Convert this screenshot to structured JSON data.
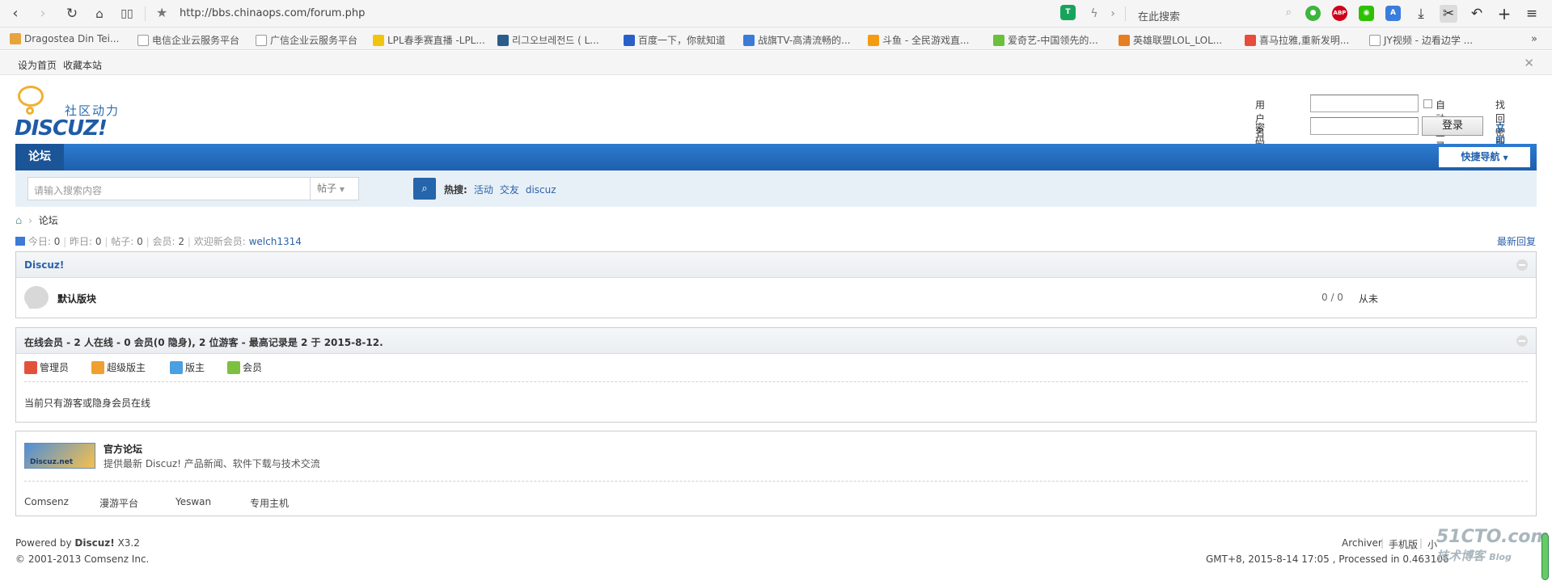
{
  "browser": {
    "url": "http://bbs.chinaops.com/forum.php",
    "search_placeholder": "在此搜索",
    "bookmarks": [
      "Dragostea Din Tei...",
      "电信企业云服务平台",
      "广信企业云服务平台",
      "LPL春季赛直播 -LPL...",
      "리그오브레전드 ( L...",
      "百度一下，你就知道",
      "战旗TV-高清流畅的...",
      "斗鱼 - 全民游戏直...",
      "爱奇艺-中国领先的...",
      "英雄联盟LOL_LOL...",
      "喜马拉雅,重新发明...",
      "JY视频 - 边看边学 ..."
    ],
    "bookmark_colors": [
      "#e8a33c",
      "#ffffff",
      "#ffffff",
      "#f1c40f",
      "#2b5d8b",
      "#2b5fc8",
      "#3c7bd6",
      "#f39c12",
      "#6cbf3a",
      "#e67e22",
      "#e74c3c",
      "#ffffff"
    ],
    "ext_labels": {
      "abp": "ABP"
    }
  },
  "site_bar": {
    "set_home": "设为首页",
    "bookmark": "收藏本站"
  },
  "logo": {
    "cn": "社区动力",
    "en": "DISCUZ!"
  },
  "login": {
    "username_label": "用户名",
    "password_label": "密码",
    "auto_login": "自动登录",
    "retrieve_password": "找回密码",
    "login_button": "登录",
    "register": "立即注册"
  },
  "nav": {
    "tab": "论坛",
    "quick_nav": "快捷导航"
  },
  "search": {
    "placeholder": "请输入搜索内容",
    "type": "帖子",
    "hot_label": "热搜:",
    "hot": [
      "活动",
      "交友",
      "discuz"
    ]
  },
  "breadcrumb": {
    "current": "论坛"
  },
  "stats": {
    "today_label": "今日:",
    "today": "0",
    "yesterday_label": "昨日:",
    "yesterday": "0",
    "posts_label": "帖子:",
    "posts": "0",
    "members_label": "会员:",
    "members": "2",
    "welcome_label": "欢迎新会员:",
    "newest_member": "welch1314",
    "latest_replies": "最新回复"
  },
  "category": {
    "title": "Discuz!",
    "forum": {
      "name": "默认版块",
      "counts": "0 / 0",
      "last_post": "从未"
    }
  },
  "online": {
    "title": "在线会员 - 2 人在线 - 0 会员(0 隐身), 2 位游客 - 最高记录是 2 于 2015-8-12.",
    "legend": [
      "管理员",
      "超级版主",
      "版主",
      "会员"
    ],
    "legend_colors": [
      "#e2523a",
      "#f0a030",
      "#4aa0e0",
      "#7cc040"
    ],
    "message": "当前只有游客或隐身会员在线"
  },
  "links": {
    "official_name": "官方论坛",
    "official_desc": "提供最新 Discuz! 产品新闻、软件下载与技术交流",
    "banner_text": "Discuz.net",
    "friends": [
      "Comsenz",
      "漫游平台",
      "Yeswan",
      "专用主机"
    ]
  },
  "footer": {
    "powered_prefix": "Powered by",
    "powered_name": "Discuz!",
    "version": "X3.2",
    "copyright": "© 2001-2013 Comsenz Inc.",
    "links": [
      "Archiver",
      "手机版",
      "小"
    ],
    "timing": "GMT+8, 2015-8-14 17:05 , Processed in 0.463106"
  },
  "watermark": {
    "line1": "51CTO.com",
    "line2": "技术博客",
    "line3": "Blog"
  }
}
